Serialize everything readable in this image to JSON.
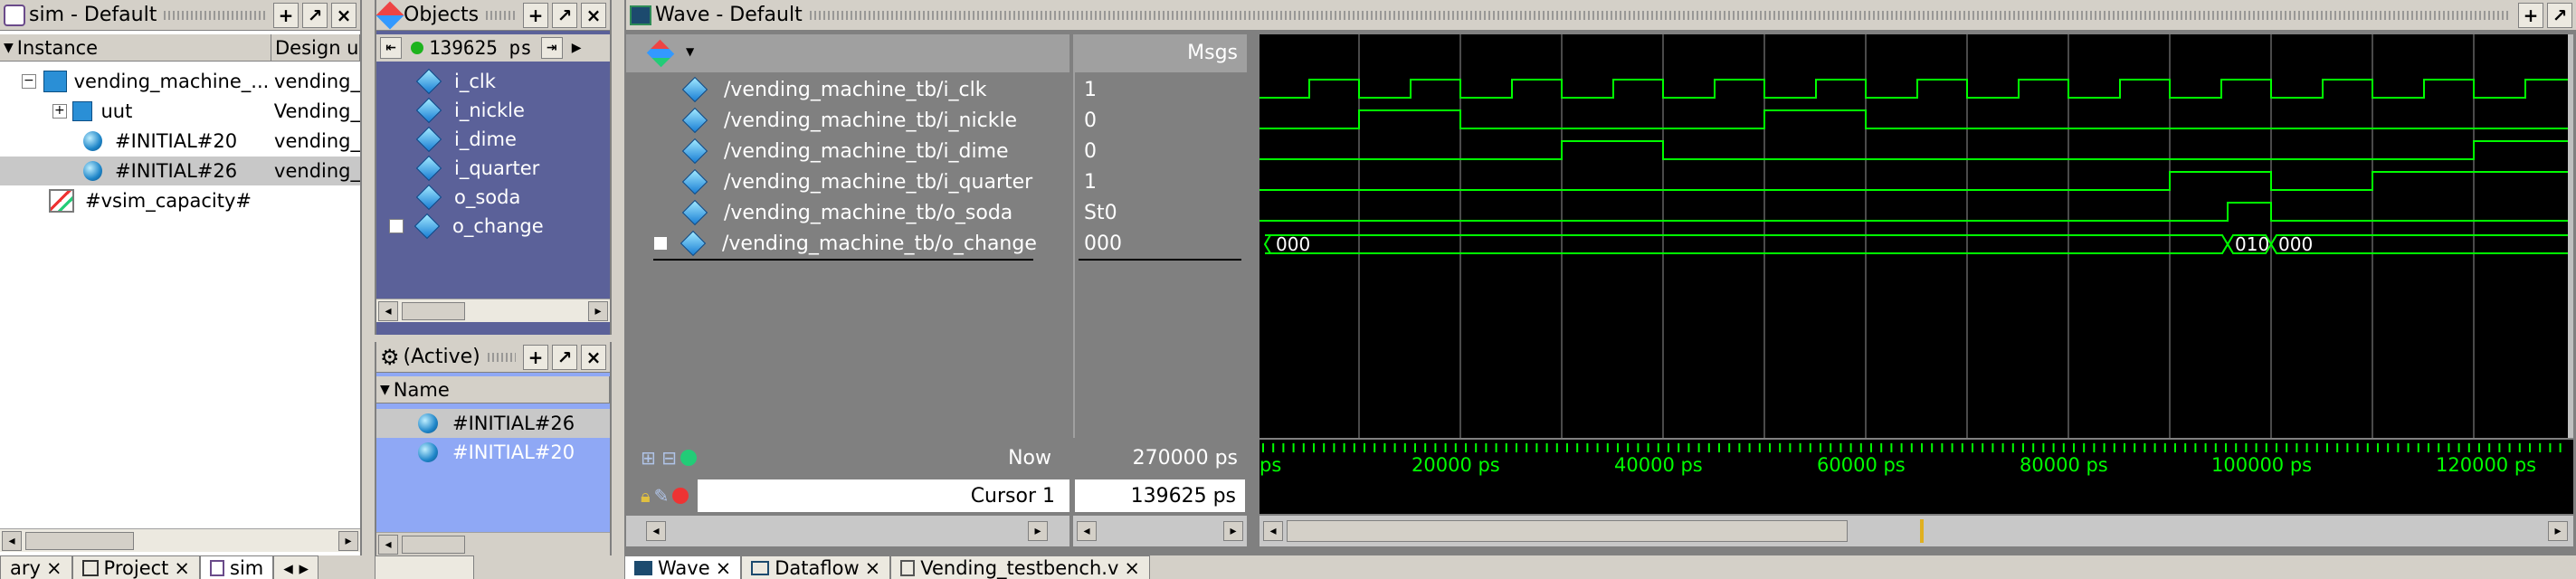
{
  "sim": {
    "title": "sim - Default",
    "col_instance": "Instance",
    "col_design": "Design ur",
    "rows": [
      {
        "name": "vending_machine_...",
        "design": "vending_"
      },
      {
        "name": "uut",
        "design": "Vending_"
      },
      {
        "name": "#INITIAL#20",
        "design": "vending_"
      },
      {
        "name": "#INITIAL#26",
        "design": "vending_"
      },
      {
        "name": "#vsim_capacity#",
        "design": ""
      }
    ]
  },
  "objects": {
    "title": "Objects",
    "time": "139625 ps",
    "items": [
      "i_clk",
      "i_nickle",
      "i_dime",
      "i_quarter",
      "o_soda",
      "o_change"
    ]
  },
  "active": {
    "title": "(Active)",
    "col_name": "Name",
    "items": [
      "#INITIAL#26",
      "#INITIAL#20"
    ]
  },
  "wave": {
    "title": "Wave - Default",
    "msgs_label": "Msgs",
    "signals": [
      {
        "name": "/vending_machine_tb/i_clk",
        "value": "1"
      },
      {
        "name": "/vending_machine_tb/i_nickle",
        "value": "0"
      },
      {
        "name": "/vending_machine_tb/i_dime",
        "value": "0"
      },
      {
        "name": "/vending_machine_tb/i_quarter",
        "value": "1"
      },
      {
        "name": "/vending_machine_tb/o_soda",
        "value": "St0"
      },
      {
        "name": "/vending_machine_tb/o_change",
        "value": "000"
      }
    ],
    "bus_values": [
      "000",
      "010",
      "000"
    ],
    "now_label": "Now",
    "now_value": "270000 ps",
    "cursor_label": "Cursor 1",
    "cursor_value": "139625 ps",
    "time_ticks": [
      "ps",
      "20000 ps",
      "40000 ps",
      "60000 ps",
      "80000 ps",
      "100000 ps",
      "120000 ps"
    ],
    "colors": {
      "signal": "#00ff00",
      "background": "#000000",
      "grid": "#4a4a4a",
      "ticks": "#00ff00"
    }
  },
  "bottom_tabs_left": [
    "ary",
    "Project",
    "sim"
  ],
  "bottom_tabs_right": [
    "Wave",
    "Dataflow",
    "Vending_testbench.v"
  ]
}
